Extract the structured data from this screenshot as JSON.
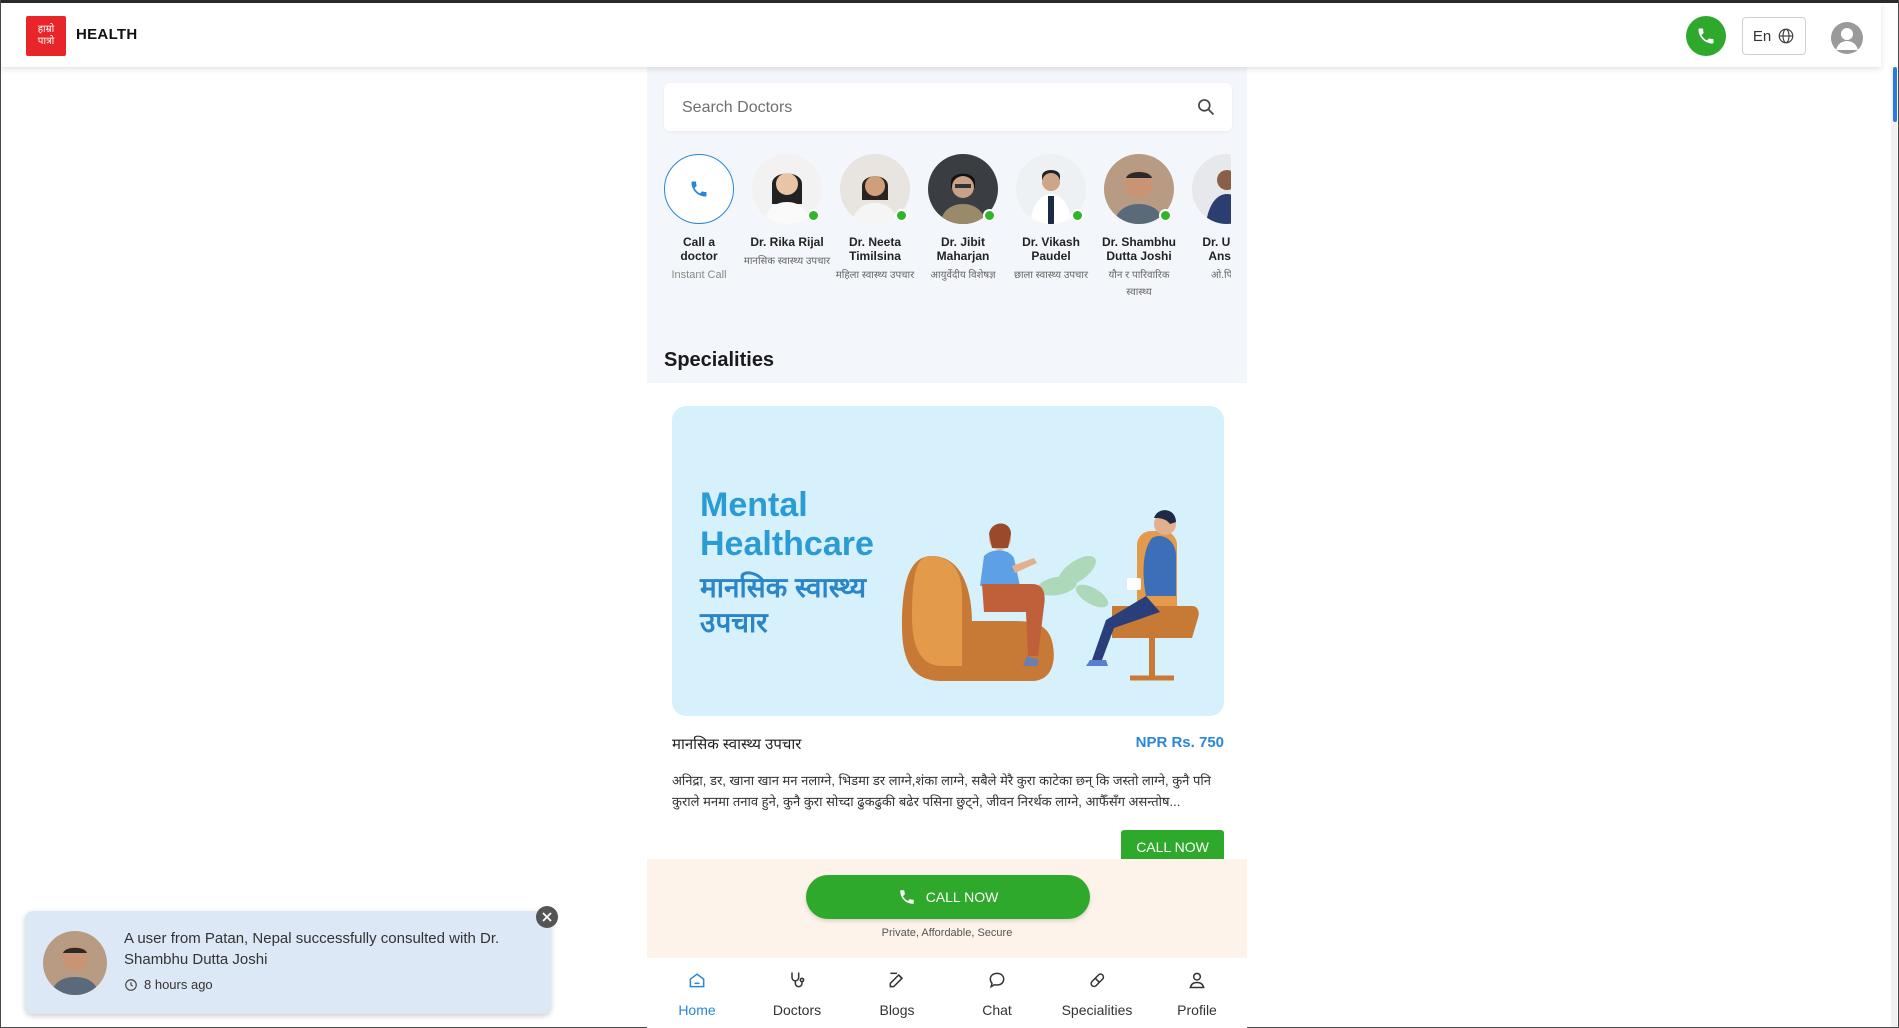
{
  "header": {
    "logo_line1": "हाम्रो",
    "logo_line2": "पात्रो",
    "brand": "HEALTH",
    "language": "En"
  },
  "search": {
    "placeholder": "Search Doctors"
  },
  "call_tile": {
    "title_line1": "Call a",
    "title_line2": "doctor",
    "subtitle": "Instant Call"
  },
  "doctors": [
    {
      "name": "Dr. Rika Rijal",
      "specialty": "मानसिक स्वास्थ्य उपचार"
    },
    {
      "name": "Dr. Neeta Timilsina",
      "specialty": "महिला स्वास्थ्य उपचार"
    },
    {
      "name": "Dr. Jibit Maharjan",
      "specialty": "आयुर्वेदीय विशेषज्ञ"
    },
    {
      "name": "Dr. Vikash Paudel",
      "specialty": "छाला स्वास्थ्य उपचार"
    },
    {
      "name": "Dr. Shambhu Dutta Joshi",
      "specialty": "यौन र पारिवारिक स्वास्थ्य"
    },
    {
      "name": "Dr. Ubed Ansari",
      "specialty": "ओ.पि.डी"
    }
  ],
  "specialities": {
    "title": "Specialities",
    "banner": {
      "title_line1": "Mental",
      "title_line2": "Healthcare",
      "subtitle": "मानसिक स्वास्थ्य उपचार"
    },
    "card": {
      "name": "मानसिक स्वास्थ्य उपचार",
      "price": "NPR Rs. 750",
      "description": "अनिद्रा, डर, खाना खान मन नलाग्ने, भिडमा डर लाग्ने,शंका लाग्ने, सबैले मेरै कुरा काटेका छन् कि जस्तो लाग्ने, कुनै पनि कुराले मनमा तनाव हुने, कुनै कुरा सोच्दा ढुकढुकी बढेर पसिना छुट्ने, जीवन निरर्थक लाग्ने, आफैँसँग असन्तोष...",
      "call_label": "CALL NOW"
    }
  },
  "cta": {
    "label": "CALL NOW",
    "subtext": "Private, Affordable, Secure"
  },
  "nav": {
    "items": [
      {
        "label": "Home",
        "icon": "home-icon",
        "active": true
      },
      {
        "label": "Doctors",
        "icon": "stethoscope-icon",
        "active": false
      },
      {
        "label": "Blogs",
        "icon": "edit-icon",
        "active": false
      },
      {
        "label": "Chat",
        "icon": "chat-icon",
        "active": false
      },
      {
        "label": "Specialities",
        "icon": "pill-icon",
        "active": false
      },
      {
        "label": "Profile",
        "icon": "user-icon",
        "active": false
      }
    ]
  },
  "toast": {
    "message": "A user from Patan, Nepal successfully consulted with Dr. Shambhu Dutta Joshi",
    "time": "8 hours ago"
  },
  "colors": {
    "brand_red": "#e8262a",
    "green": "#2fa92b",
    "blue": "#2a86d8",
    "banner_bg": "#d6f1fb",
    "toast_bg": "#dce8f6"
  }
}
